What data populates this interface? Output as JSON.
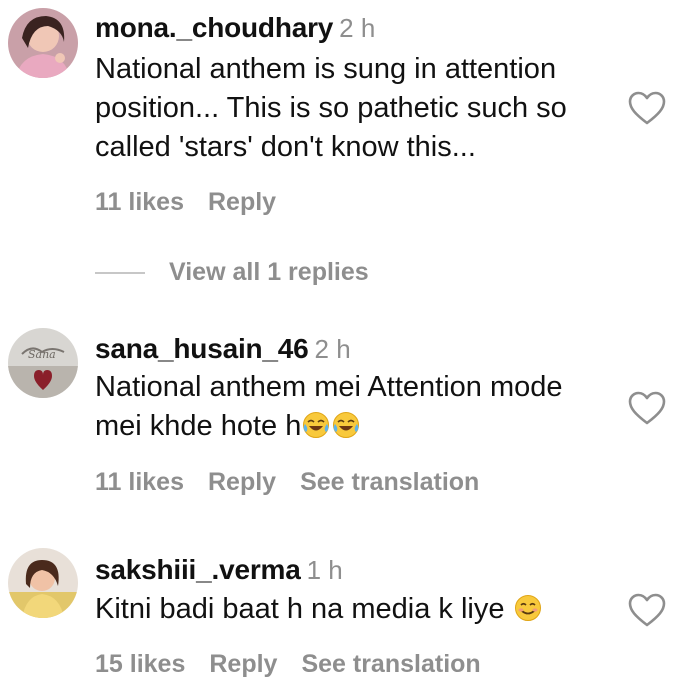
{
  "comments": [
    {
      "username": "mona._choudhary",
      "time": "2 h",
      "text_lines": [
        "National anthem is sung in attention",
        "position... This is so pathetic such so",
        "called 'stars' don't know this..."
      ],
      "likes": "11 likes",
      "reply": "Reply",
      "view_replies": "View all 1 replies"
    },
    {
      "username": "sana_husain_46",
      "time": "2 h",
      "text_lines": [
        "National anthem mei Attention mode",
        "mei khde hote h"
      ],
      "emoji": "tears-of-joy-emoji x2",
      "likes": "11 likes",
      "reply": "Reply",
      "see_translation": "See translation"
    },
    {
      "username": "sakshiii_.verma",
      "time": "1 h",
      "text_lines": [
        "Kitni badi baat h na media k liye"
      ],
      "emoji": "smiling-face-emoji",
      "likes": "15 likes",
      "reply": "Reply",
      "see_translation": "See translation"
    }
  ],
  "colors": {
    "text": "#111111",
    "muted": "#8e8e8e",
    "divider": "#c7c7c7"
  },
  "icons": {
    "like": "heart-outline-icon"
  }
}
